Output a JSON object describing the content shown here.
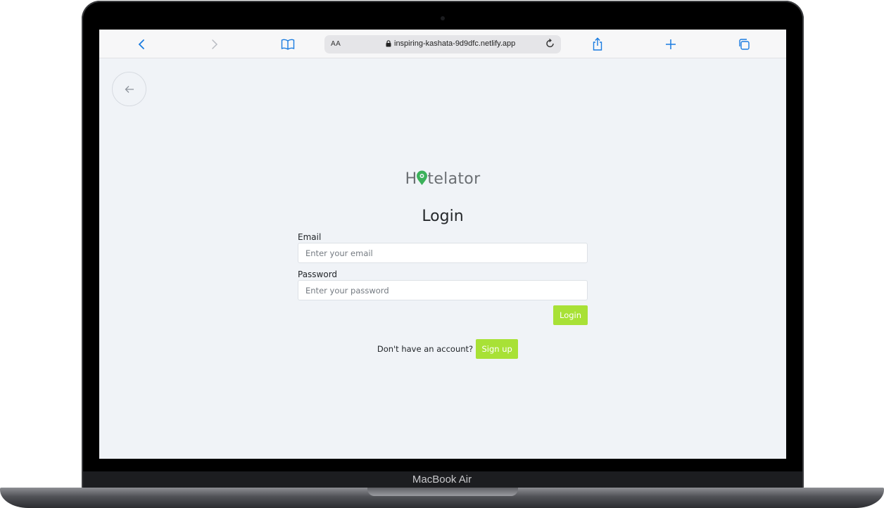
{
  "device": {
    "label": "MacBook Air"
  },
  "browser": {
    "text_size_label": "AA",
    "url": "inspiring-kashata-9d9dfc.netlify.app"
  },
  "page": {
    "brand_prefix": "H",
    "brand_suffix": "telator",
    "title": "Login",
    "email": {
      "label": "Email",
      "placeholder": "Enter your email"
    },
    "password": {
      "label": "Password",
      "placeholder": "Enter your password"
    },
    "login_button": "Login",
    "signup_prompt": "Don't have an account?",
    "signup_button": "Sign up"
  },
  "colors": {
    "accent_green": "#a8e136",
    "pin_green": "#3cb15a",
    "browser_blue": "#1a7ce0"
  }
}
